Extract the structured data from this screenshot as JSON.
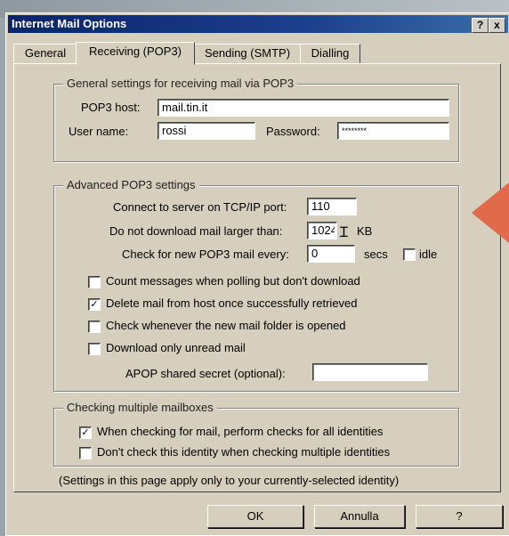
{
  "window": {
    "title": "Internet Mail Options",
    "help_label": "?",
    "close_label": "x"
  },
  "tabs": [
    "General",
    "Receiving (POP3)",
    "Sending (SMTP)",
    "Dialling"
  ],
  "general_group": {
    "legend": "General settings for receiving mail via POP3",
    "pop3_host_label": "POP3 host:",
    "pop3_host_value": "mail.tin.it",
    "username_label": "User name:",
    "username_value": "rossi",
    "password_label": "Password:",
    "password_value": "********"
  },
  "advanced_group": {
    "legend": "Advanced POP3 settings",
    "port_label": "Connect to server on TCP/IP port:",
    "port_value": "110",
    "maxsize_label": "Do not download mail larger than:",
    "maxsize_value": "1024",
    "maxsize_unit": "KB",
    "check_every_label": "Check for new POP3 mail every:",
    "check_every_value": "0",
    "check_every_unit": "secs",
    "idle_label": "idle",
    "options": [
      {
        "label": "Count messages when polling but don't download",
        "checked": false
      },
      {
        "label": "Delete mail from host once successfully retrieved",
        "checked": true
      },
      {
        "label": "Check whenever the new mail folder is opened",
        "checked": false
      },
      {
        "label": "Download only unread mail",
        "checked": false
      }
    ],
    "apop_label": "APOP shared secret (optional):",
    "apop_value": ""
  },
  "multiple_group": {
    "legend": "Checking multiple mailboxes",
    "options": [
      {
        "label": "When checking for mail, perform checks for all identities",
        "checked": true
      },
      {
        "label": "Don't check this identity when checking multiple identities",
        "checked": false
      }
    ]
  },
  "footer_note": "(Settings in this page apply only to your currently-selected identity)",
  "buttons": {
    "ok": "OK",
    "cancel": "Annulla",
    "help": "?"
  },
  "check_mark": "✓",
  "accent_arrow_color": "#e06a4a"
}
